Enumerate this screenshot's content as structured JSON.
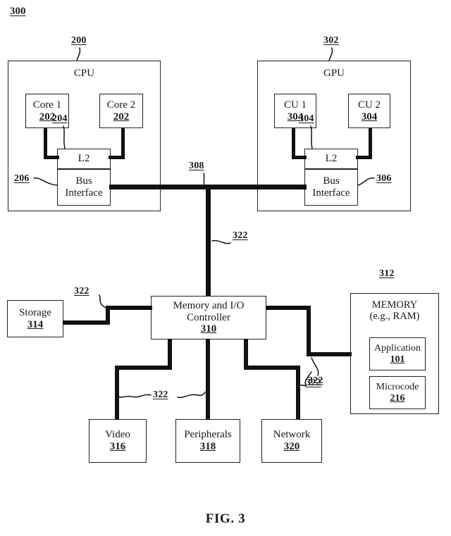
{
  "figure": {
    "sheet_number": "300",
    "caption": "FIG. 3"
  },
  "cpu_block": {
    "ref": "200",
    "title": "CPU",
    "cores": [
      {
        "label": "Core 1",
        "ref": "202"
      },
      {
        "label": "Core 2",
        "ref": "202"
      }
    ],
    "cache": {
      "label": "L2",
      "ref": "204"
    },
    "bus_interface": {
      "line1": "Bus",
      "line2": "Interface",
      "ref": "206"
    }
  },
  "gpu_block": {
    "ref": "302",
    "title": "GPU",
    "compute_units": [
      {
        "label": "CU 1",
        "ref": "304"
      },
      {
        "label": "CU 2",
        "ref": "304"
      }
    ],
    "cache": {
      "label": "L2",
      "ref": "304"
    },
    "bus_interface": {
      "line1": "Bus",
      "line2": "Interface",
      "ref": "306"
    }
  },
  "interconnect": {
    "system_bus_ref": "308",
    "link_ref": "322",
    "link_refs": [
      "322",
      "322",
      "322",
      "322",
      "322"
    ]
  },
  "controller": {
    "line1": "Memory and I/O",
    "line2": "Controller",
    "ref": "310"
  },
  "memory_block": {
    "ref": "312",
    "title": "MEMORY",
    "subtitle": "(e.g., RAM)",
    "contents": [
      {
        "label": "Application",
        "ref": "101"
      },
      {
        "label": "Microcode",
        "ref": "216"
      }
    ]
  },
  "storage_block": {
    "label": "Storage",
    "ref": "314"
  },
  "peripheral_blocks": [
    {
      "label": "Video",
      "ref": "316"
    },
    {
      "label": "Peripherals",
      "ref": "318"
    },
    {
      "label": "Network",
      "ref": "320"
    }
  ]
}
